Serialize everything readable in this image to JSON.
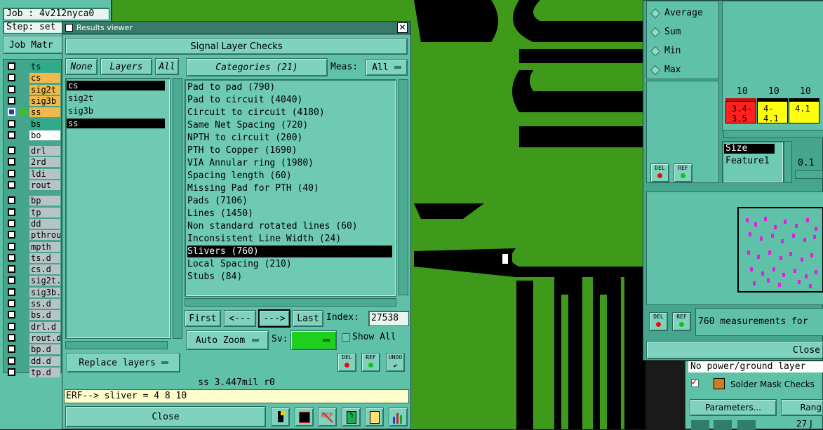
{
  "job_panel": {
    "job": "Job : 4v212nyca0",
    "step": "Step: set",
    "matrix_btn": "Job Matr"
  },
  "layers_left": [
    "ts",
    "cs",
    "sig2t",
    "sig3b",
    "ss",
    "bs",
    "bo",
    "drl",
    "2rd",
    "ldi",
    "rout",
    "bp",
    "tp",
    "dd",
    "pthrou",
    "mpth",
    "ts.d",
    "cs.d",
    "sig2t.",
    "sig3b.",
    "ss.d",
    "bs.d",
    "drl.d",
    "rout.d",
    "bp.d",
    "dd.d",
    "tp.d"
  ],
  "layer_colors": {
    "ts": "#2faa8a",
    "cs": "#f0b94a",
    "sig2t": "#f0b94a",
    "sig3b": "#f0b94a",
    "ss": "#f0b94a",
    "bs": "#2faa8a",
    "bo": "#ffffff",
    "other": "#b7c4c6"
  },
  "dialog": {
    "title": "Results viewer",
    "header": "Signal Layer Checks",
    "none_btn": "None",
    "layers_btn": "Layers",
    "all_btn": "All",
    "layers": [
      "cs",
      "sig2t",
      "sig3b",
      "ss"
    ],
    "selected_layers": [
      "cs",
      "ss"
    ],
    "categories_btn": "Categories (21)",
    "meas_label": "Meas:",
    "meas_value": "All",
    "categories": [
      "Pad to pad (790)",
      "Pad to circuit (4040)",
      "Circuit to circuit (4180)",
      "Same Net Spacing (720)",
      "NPTH to circuit (200)",
      "PTH to Copper (1690)",
      "VIA Annular ring (1980)",
      "Spacing length (60)",
      "Missing Pad for PTH (40)",
      "Pads (7106)",
      "Lines (1450)",
      "Non standard rotated lines (60)",
      "Inconsistent Line Width (24)",
      "Slivers (760)",
      "Local Spacing (210)",
      "Stubs (84)"
    ],
    "selected_category": "Slivers (760)",
    "first_btn": "First",
    "prev_btn": "<---",
    "next_btn": "--->",
    "last_btn": "Last",
    "index_label": "Index:",
    "index_value": "27538",
    "auto_zoom": "Auto Zoom",
    "sv_label": "Sv:",
    "show_all": "Show All",
    "replace_layers": "Replace layers",
    "del": "DEL",
    "ref": "REF",
    "undo": "UNDO",
    "status": "ss 3.447mil  r0",
    "erf": "ERF--> sliver = 4 8 10",
    "close": "Close"
  },
  "right_panel": {
    "stats": [
      "Average",
      "Sum",
      "Min",
      "Max"
    ],
    "hist_labels": [
      "10",
      "10",
      "10"
    ],
    "hist_values": [
      "3.4-\n3.5",
      "4-\n4.1",
      "4.1"
    ],
    "hist_colors": [
      "#ff2020",
      "#ffff10",
      "#ffff10"
    ],
    "list": [
      "Size",
      "Feature1"
    ],
    "value": "0.1",
    "del": "DEL",
    "ref": "REF",
    "measurements": "760 measurements for",
    "close": "Close"
  },
  "bottom_right": {
    "msg": "No power/ground layer",
    "solder_mask": "Solder Mask Checks",
    "parameters": "Parameters...",
    "range": "Rang",
    "date": "27 J"
  }
}
